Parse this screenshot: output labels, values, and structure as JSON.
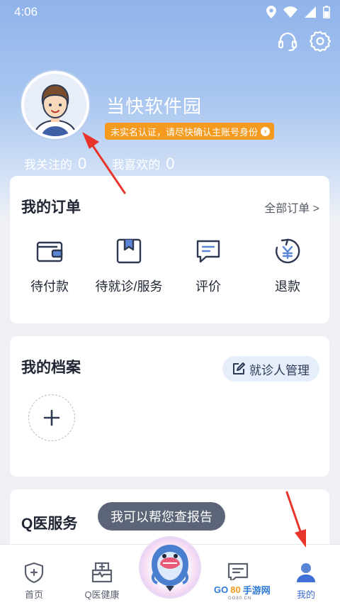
{
  "status_bar": {
    "time": "4:06"
  },
  "profile": {
    "username": "当快软件园",
    "verify_notice": "未实名认证，请尽快确认主账号身份",
    "stats": [
      {
        "label": "我关注的",
        "count": "0"
      },
      {
        "label": "我喜欢的",
        "count": "0"
      }
    ]
  },
  "orders": {
    "title": "我的订单",
    "all_link": "全部订单 >",
    "items": [
      {
        "label": "待付款",
        "icon": "wallet-icon"
      },
      {
        "label": "待就诊/服务",
        "icon": "bookmark-box-icon"
      },
      {
        "label": "评价",
        "icon": "comment-icon"
      },
      {
        "label": "退款",
        "icon": "refund-icon"
      }
    ]
  },
  "archive": {
    "title": "我的档案",
    "manage_label": "就诊人管理"
  },
  "qservice": {
    "title": "Q医服务",
    "tip": "我可以帮您查报告"
  },
  "tabbar": {
    "tabs": [
      {
        "label": "首页",
        "icon": "home-shield-icon"
      },
      {
        "label": "Q医健康",
        "icon": "medical-box-icon"
      },
      {
        "label": "",
        "icon": "dolphin-mascot-icon"
      },
      {
        "label": "",
        "icon": "message-icon"
      },
      {
        "label": "我的",
        "icon": "person-icon"
      }
    ],
    "active_index": 4
  },
  "watermark": {
    "g": "GO",
    "o": "80",
    "c": "手游网",
    "sub": "GO80.CN"
  },
  "colors": {
    "accent": "#3f6fd6",
    "badge": "#f39a1f",
    "arrow": "#e8342b",
    "header": "#9dbcec"
  }
}
